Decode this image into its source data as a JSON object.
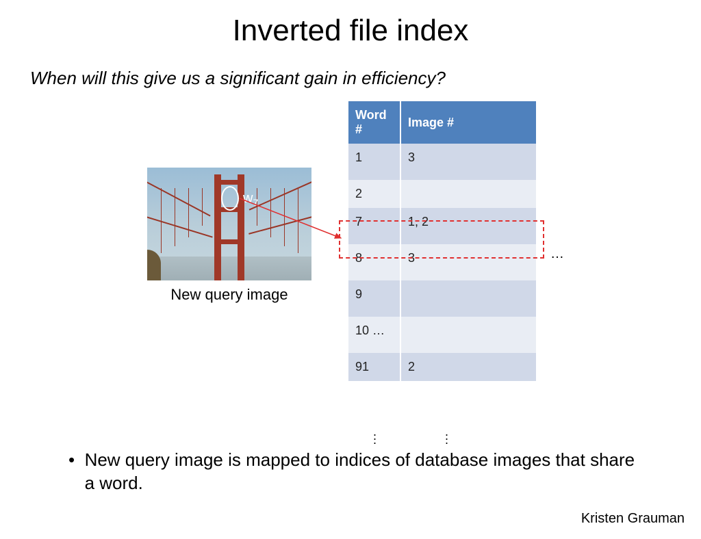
{
  "title": "Inverted file index",
  "question": "When will this give us a significant gain in efficiency?",
  "query_caption": "New query image",
  "annotation_label": "w",
  "annotation_subscript": "7",
  "table": {
    "headers": {
      "word": "Word #",
      "image": "Image #"
    },
    "rows": [
      {
        "word": "1",
        "image": "3"
      },
      {
        "word": "2",
        "image": ""
      },
      {
        "word": "7",
        "image": "1, 2"
      },
      {
        "word": "8",
        "image": "3"
      },
      {
        "word": "9",
        "image": ""
      },
      {
        "word": "10 …",
        "image": ""
      },
      {
        "word": "91",
        "image": "2"
      }
    ]
  },
  "ellipsis": "…",
  "bullet": "New query image is mapped to indices of database images that share a word.",
  "attribution": "Kristen Grauman"
}
